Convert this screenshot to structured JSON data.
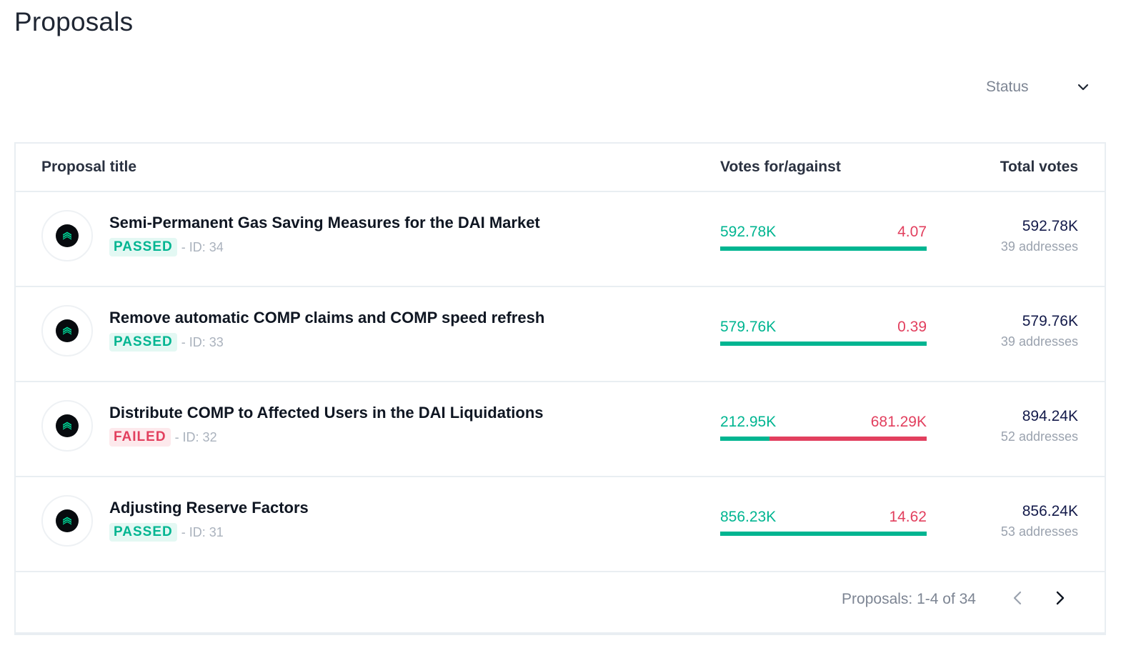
{
  "page": {
    "title": "Proposals"
  },
  "filter": {
    "label": "Status",
    "icon": "chevron-down-icon"
  },
  "table": {
    "headers": {
      "title": "Proposal title",
      "votes": "Votes for/against",
      "total": "Total votes"
    },
    "rows": [
      {
        "title": "Semi-Permanent Gas Saving Measures for the DAI Market",
        "status": "PASSED",
        "id_label": "- ID: 34",
        "votes_for": "592.78K",
        "votes_against": "4.07",
        "for_fraction": 0.99999,
        "total_votes": "592.78K",
        "addresses": "39 addresses",
        "icon": "compound-logo-icon"
      },
      {
        "title": "Remove automatic COMP claims and COMP speed refresh",
        "status": "PASSED",
        "id_label": "- ID: 33",
        "votes_for": "579.76K",
        "votes_against": "0.39",
        "for_fraction": 0.99999,
        "total_votes": "579.76K",
        "addresses": "39 addresses",
        "icon": "compound-logo-icon"
      },
      {
        "title": "Distribute COMP to Affected Users in the DAI Liquidations",
        "status": "FAILED",
        "id_label": "- ID: 32",
        "votes_for": "212.95K",
        "votes_against": "681.29K",
        "for_fraction": 0.2381,
        "total_votes": "894.24K",
        "addresses": "52 addresses",
        "icon": "compound-logo-icon"
      },
      {
        "title": "Adjusting Reserve Factors",
        "status": "PASSED",
        "id_label": "- ID: 31",
        "votes_for": "856.23K",
        "votes_against": "14.62",
        "for_fraction": 0.99998,
        "total_votes": "856.24K",
        "addresses": "53 addresses",
        "icon": "compound-logo-icon"
      }
    ]
  },
  "pagination": {
    "text": "Proposals: 1-4 of 34",
    "prev_icon": "chevron-left-icon",
    "next_icon": "chevron-right-icon"
  },
  "colors": {
    "for": "#00b591",
    "against": "#e23f5e",
    "border": "#e9eef2"
  }
}
